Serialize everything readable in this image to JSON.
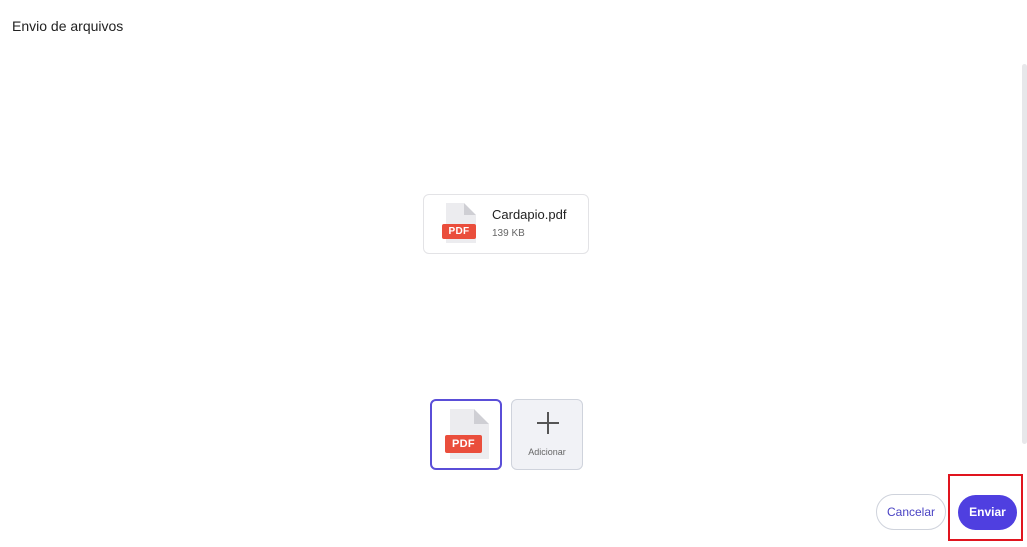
{
  "header": {
    "title": "Envio de arquivos"
  },
  "file": {
    "name": "Cardapio.pdf",
    "size": "139 KB",
    "type_badge": "PDF",
    "icon": "pdf-file-icon"
  },
  "thumbnails": {
    "items": [
      {
        "badge": "PDF",
        "selected": true,
        "icon": "pdf-file-icon"
      }
    ],
    "add_label": "Adicionar",
    "add_icon": "plus-icon"
  },
  "actions": {
    "cancel_label": "Cancelar",
    "send_label": "Enviar"
  },
  "colors": {
    "accent": "#4f3fe0",
    "pdf_badge": "#ea4e3c",
    "highlight": "#e0141e"
  }
}
